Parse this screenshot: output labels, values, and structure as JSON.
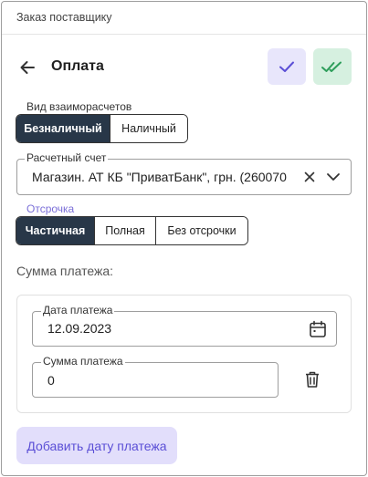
{
  "window": {
    "title": "Заказ поставщику"
  },
  "header": {
    "back_icon": "arrow-left-icon",
    "title": "Оплата",
    "confirm_icon": "check-icon",
    "confirm_all_icon": "double-check-icon",
    "colors": {
      "confirm_bg": "#e8e6fb",
      "confirm_icon": "#5b4fd6",
      "confirm_all_bg": "#d6f0e0",
      "confirm_all_icon": "#2e9e5b"
    }
  },
  "settlement": {
    "label": "Вид взаиморасчетов",
    "options": [
      "Безналичный",
      "Наличный"
    ],
    "selected": "Безналичный"
  },
  "account": {
    "label": "Расчетный счет",
    "value": "Магазин. АТ КБ \"ПриватБанк\", грн. (260070",
    "clear_icon": "close-icon",
    "dropdown_icon": "chevron-down-icon"
  },
  "deferral": {
    "label": "Отсрочка",
    "options": [
      "Частичная",
      "Полная",
      "Без отсрочки"
    ],
    "selected": "Частичная",
    "label_color": "#7b6fd8"
  },
  "payment": {
    "heading": "Сумма платежа:",
    "date_label": "Дата платежа",
    "date_value": "12.09.2023",
    "calendar_icon": "calendar-icon",
    "amount_label": "Сумма платежа",
    "amount_value": "0",
    "delete_icon": "trash-icon"
  },
  "actions": {
    "add_date_label": "Добавить дату платежа"
  },
  "colors": {
    "accent": "#5b4fd6",
    "segment_active_bg": "#283748",
    "add_button_bg": "#e2defb"
  }
}
